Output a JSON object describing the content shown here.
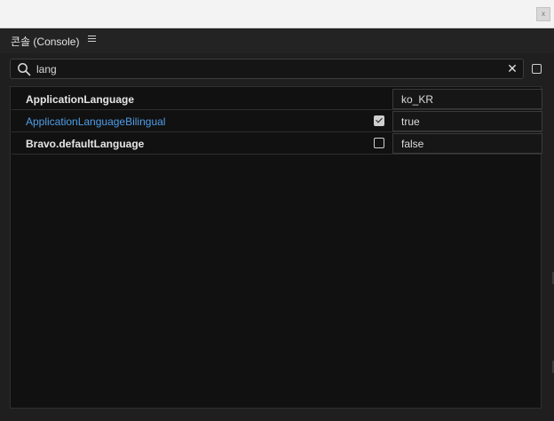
{
  "window": {
    "control_label": "x"
  },
  "panel": {
    "title": "콘솔 (Console)"
  },
  "search": {
    "value": "lang",
    "placeholder": ""
  },
  "rows": [
    {
      "name": "ApplicationLanguage",
      "style": "bold",
      "checkbox": null,
      "value": "ko_KR"
    },
    {
      "name": "ApplicationLanguageBilingual",
      "style": "link",
      "checkbox": true,
      "value": "true"
    },
    {
      "name": "Bravo.defaultLanguage",
      "style": "bold",
      "checkbox": false,
      "value": "false"
    }
  ],
  "colors": {
    "link": "#4f9ee8",
    "background": "#111111",
    "header": "#232323"
  },
  "icons": {
    "search": "search-icon",
    "clear": "close-icon",
    "menu": "menu-icon"
  }
}
